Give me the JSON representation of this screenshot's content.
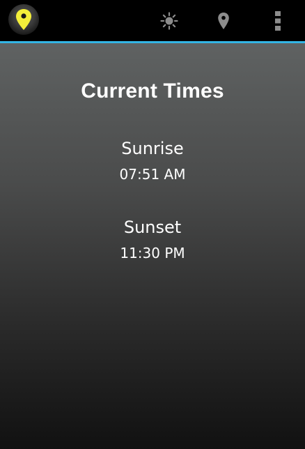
{
  "action_bar": {
    "icons": {
      "app": "map-pin-icon",
      "sun": "sun-icon",
      "location": "location-pin-icon",
      "overflow": "overflow-menu-icon"
    },
    "accent_color": "#33b5e5",
    "app_icon_color": "#f4ef3a"
  },
  "main": {
    "title": "Current Times",
    "sunrise": {
      "label": "Sunrise",
      "time": "07:51 AM"
    },
    "sunset": {
      "label": "Sunset",
      "time": "11:30 PM"
    }
  }
}
